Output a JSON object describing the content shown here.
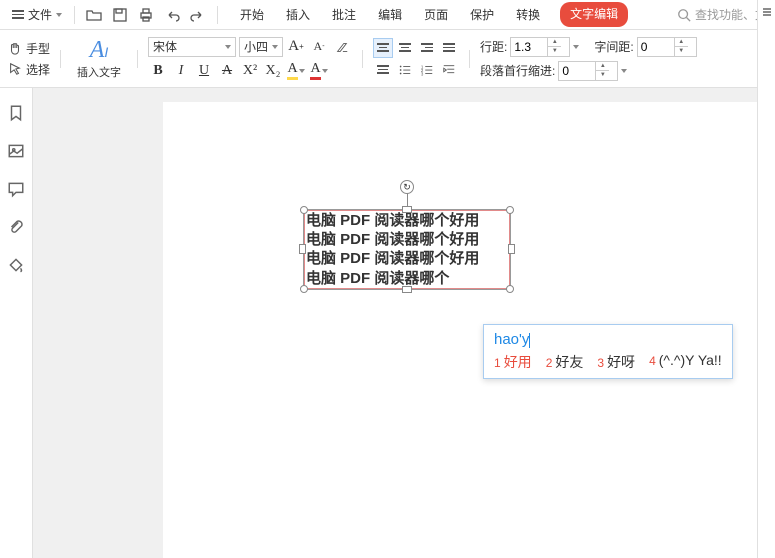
{
  "topbar": {
    "file_label": "文件",
    "tabs": [
      "开始",
      "插入",
      "批注",
      "编辑",
      "页面",
      "保护",
      "转换"
    ],
    "edit_mode": "文字编辑",
    "search_placeholder": "查找功能、文"
  },
  "ribbon": {
    "hand_label": "手型",
    "select_label": "选择",
    "insert_text_label": "插入文字",
    "font_name": "宋体",
    "font_size": "小四",
    "line_spacing_label": "行距:",
    "line_spacing_value": "1.3",
    "char_spacing_label": "字间距:",
    "char_spacing_value": "0",
    "first_indent_label": "段落首行缩进:",
    "first_indent_value": "0",
    "bold": "B",
    "italic": "I",
    "underline": "U",
    "strike": "A",
    "superscript": "X²",
    "subscript": "X₂"
  },
  "textbox": {
    "lines": [
      "电脑 PDF 阅读器哪个好用",
      "电脑 PDF 阅读器哪个好用",
      "电脑 PDF 阅读器哪个好用",
      "电脑 PDF 阅读器哪个"
    ]
  },
  "ime": {
    "input": "hao'y",
    "candidates": [
      {
        "n": "1",
        "t": "好用"
      },
      {
        "n": "2",
        "t": "好友"
      },
      {
        "n": "3",
        "t": "好呀"
      },
      {
        "n": "4",
        "t": "(^.^)Y Ya!!"
      }
    ]
  }
}
